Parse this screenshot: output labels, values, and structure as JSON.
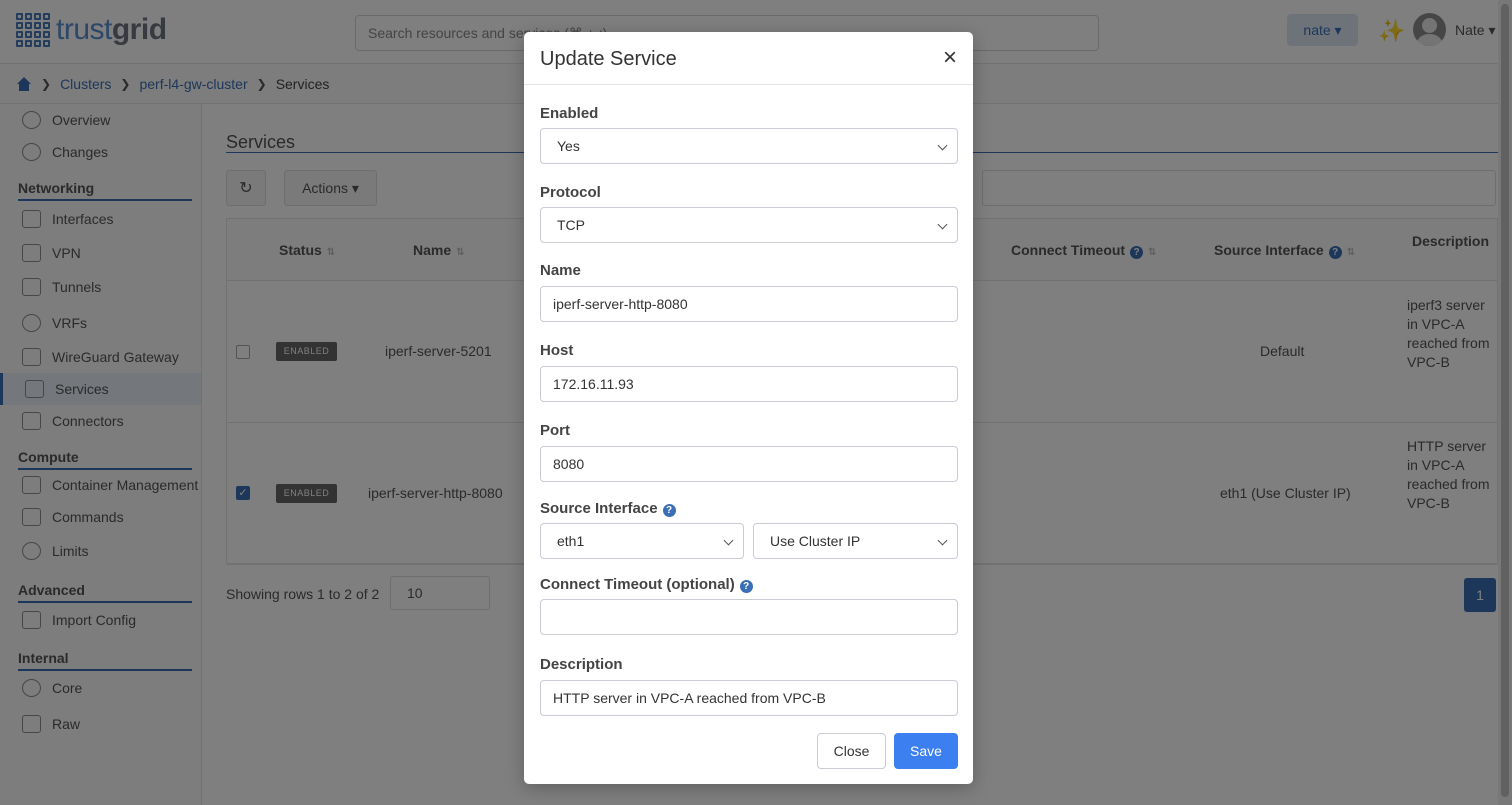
{
  "header": {
    "logo_light": "trust",
    "logo_bold": "grid",
    "search_placeholder": "Search resources and services (⌘ + ;)",
    "org_label": "nate ▾",
    "user_label": "Nate ▾"
  },
  "breadcrumb": {
    "items": [
      "Clusters",
      "perf-l4-gw-cluster"
    ],
    "current": "Services"
  },
  "sidebar": {
    "top_items": [
      "Overview",
      "Changes"
    ],
    "sections": [
      {
        "title": "Networking",
        "items": [
          "Interfaces",
          "VPN",
          "Tunnels",
          "VRFs",
          "WireGuard Gateway",
          "Services",
          "Connectors"
        ]
      },
      {
        "title": "Compute",
        "items": [
          "Container Management",
          "Commands",
          "Limits"
        ]
      },
      {
        "title": "Advanced",
        "items": [
          "Import Config"
        ]
      },
      {
        "title": "Internal",
        "items": [
          "Core",
          "Raw"
        ]
      }
    ],
    "active_item": "Services"
  },
  "main": {
    "title": "Services",
    "actions_label": "Actions ▾",
    "columns": [
      "Status",
      "Name",
      "Connect Timeout",
      "Source Interface",
      "Description"
    ],
    "rows": [
      {
        "checked": false,
        "status": "ENABLED",
        "name": "iperf-server-5201",
        "source_interface": "Default",
        "description": "iperf3 server in VPC-A reached from VPC-B"
      },
      {
        "checked": true,
        "status": "ENABLED",
        "name": "iperf-server-http-8080",
        "source_interface": "eth1 (Use Cluster IP)",
        "description": "HTTP server in VPC-A reached from VPC-B"
      }
    ],
    "showing_text": "Showing rows 1 to 2 of 2",
    "page_size": "10",
    "current_page": "1"
  },
  "modal": {
    "title": "Update Service",
    "enabled_label": "Enabled",
    "enabled_value": "Yes",
    "protocol_label": "Protocol",
    "protocol_value": "TCP",
    "name_label": "Name",
    "name_value": "iperf-server-http-8080",
    "host_label": "Host",
    "host_value": "172.16.11.93",
    "port_label": "Port",
    "port_value": "8080",
    "source_interface_label": "Source Interface",
    "source_interface_value": "eth1",
    "source_ip_mode_value": "Use Cluster IP",
    "connect_timeout_label": "Connect Timeout (optional)",
    "connect_timeout_value": "",
    "description_label": "Description",
    "description_value": "HTTP server in VPC-A reached from VPC-B",
    "close_label": "Close",
    "save_label": "Save"
  },
  "colors": {
    "accent": "#3a6fb5",
    "save_button": "#3c7ff0",
    "overlay": "rgba(0,0,0,0.5)"
  }
}
